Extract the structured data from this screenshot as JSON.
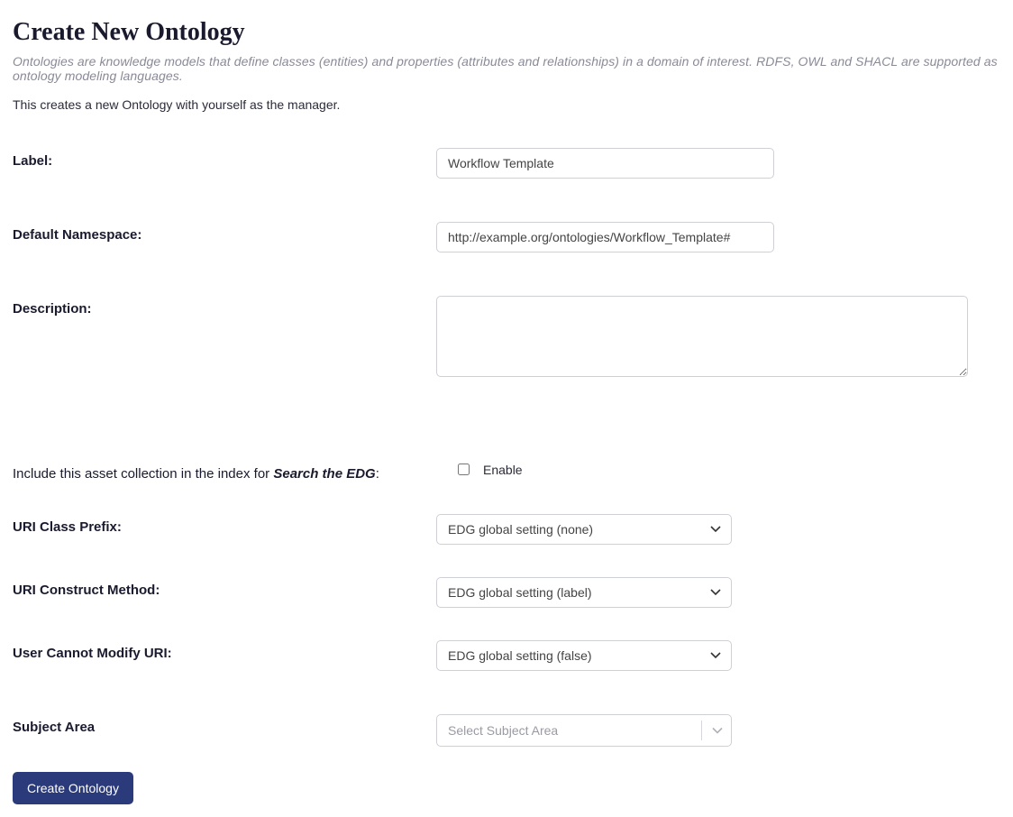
{
  "page": {
    "title": "Create New Ontology",
    "intro_italic": "Ontologies are knowledge models that define classes (entities) and properties (attributes and relationships) in a domain of interest. RDFS, OWL and SHACL are supported as ontology modeling languages.",
    "intro_line": "This creates a new Ontology with yourself as the manager."
  },
  "form": {
    "label": {
      "label": "Label:",
      "value": "Workflow Template"
    },
    "namespace": {
      "label": "Default Namespace:",
      "value": "http://example.org/ontologies/Workflow_Template#"
    },
    "description": {
      "label": "Description:",
      "value": ""
    },
    "search_index": {
      "label_prefix": "Include this asset collection in the index for ",
      "label_italic": "Search the EDG",
      "label_suffix": ":",
      "checkbox_label": "Enable",
      "checked": false
    },
    "uri_class_prefix": {
      "label": "URI Class Prefix:",
      "value": "EDG global setting (none)"
    },
    "uri_construct_method": {
      "label": "URI Construct Method:",
      "value": "EDG global setting (label)"
    },
    "user_cannot_modify_uri": {
      "label": "User Cannot Modify URI:",
      "value": "EDG global setting (false)"
    },
    "subject_area": {
      "label": "Subject Area",
      "placeholder": "Select Subject Area"
    },
    "submit": "Create Ontology"
  }
}
